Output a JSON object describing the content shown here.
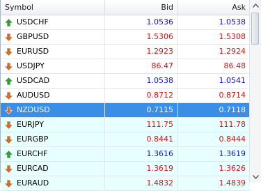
{
  "columns": {
    "symbol": "Symbol",
    "bid": "Bid",
    "ask": "Ask"
  },
  "colors": {
    "up_arrow": "#2aa52a",
    "down_arrow": "#e06a1a",
    "rise_text": "#1010e0",
    "fall_text": "#e01010",
    "selected_bg": "#3a8ee6",
    "alt_bg": "#e8ffff"
  },
  "rows": [
    {
      "symbol": "USDCHF",
      "bid": "1.0536",
      "ask": "1.0538",
      "trend": "up"
    },
    {
      "symbol": "GBPUSD",
      "bid": "1.5306",
      "ask": "1.5308",
      "trend": "down"
    },
    {
      "symbol": "EURUSD",
      "bid": "1.2923",
      "ask": "1.2924",
      "trend": "down"
    },
    {
      "symbol": "USDJPY",
      "bid": "86.47",
      "ask": "86.48",
      "trend": "down"
    },
    {
      "symbol": "USDCAD",
      "bid": "1.0538",
      "ask": "1.0541",
      "trend": "up"
    },
    {
      "symbol": "AUDUSD",
      "bid": "0.8712",
      "ask": "0.8714",
      "trend": "down"
    },
    {
      "symbol": "NZDUSD",
      "bid": "0.7115",
      "ask": "0.7118",
      "trend": "down",
      "selected": true
    },
    {
      "symbol": "EURJPY",
      "bid": "111.75",
      "ask": "111.78",
      "trend": "down"
    },
    {
      "symbol": "EURGBP",
      "bid": "0.8441",
      "ask": "0.8444",
      "trend": "down"
    },
    {
      "symbol": "EURCHF",
      "bid": "1.3616",
      "ask": "1.3619",
      "trend": "up"
    },
    {
      "symbol": "EURCAD",
      "bid": "1.3619",
      "ask": "1.3626",
      "trend": "down"
    },
    {
      "symbol": "EURAUD",
      "bid": "1.4832",
      "ask": "1.4839",
      "trend": "down"
    }
  ],
  "scrollbar": {
    "up_icon": "scroll-up-arrow",
    "down_icon": "scroll-down-arrow"
  }
}
